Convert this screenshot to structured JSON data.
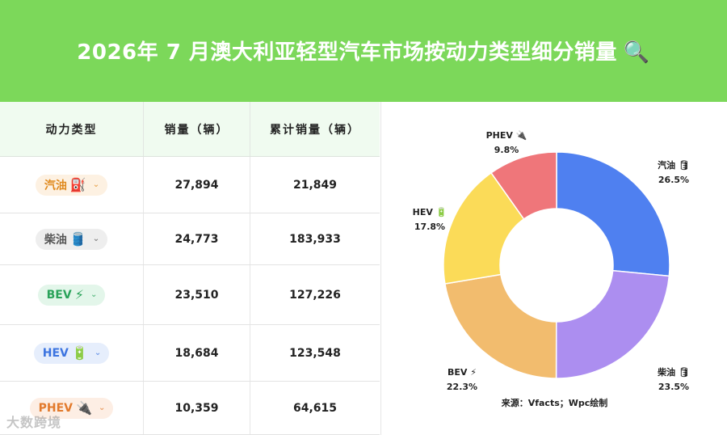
{
  "header": {
    "title": "2026年 7 月澳大利亚轻型汽车市场按动力类型细分销量",
    "icon": "🔍"
  },
  "table": {
    "headers": [
      "动力类型",
      "销量（辆）",
      "累计销量（辆）"
    ],
    "rows": [
      {
        "type": "汽油",
        "emoji": "⛽",
        "sales": "27,894",
        "cumulative": "21,849",
        "chip_bg": "#fdf1e2",
        "chip_fg": "#e08a1e"
      },
      {
        "type": "柴油",
        "emoji": "🛢️",
        "sales": "24,773",
        "cumulative": "183,933",
        "chip_bg": "#eeeeee",
        "chip_fg": "#555555"
      },
      {
        "type": "BEV",
        "emoji": "⚡",
        "sales": "23,510",
        "cumulative": "127,226",
        "chip_bg": "#e3f6ea",
        "chip_fg": "#2aa35a"
      },
      {
        "type": "HEV",
        "emoji": "🔋",
        "sales": "18,684",
        "cumulative": "123,548",
        "chip_bg": "#e6eefc",
        "chip_fg": "#3c74e0"
      },
      {
        "type": "PHEV",
        "emoji": "🔌",
        "sales": "10,359",
        "cumulative": "64,615",
        "chip_bg": "#fdeee4",
        "chip_fg": "#e27a2c"
      }
    ]
  },
  "chart_data": {
    "type": "pie",
    "categories": [
      "汽油",
      "柴油",
      "BEV",
      "HEV",
      "PHEV"
    ],
    "values": [
      26.5,
      23.5,
      22.3,
      17.8,
      9.8
    ],
    "labels": [
      "汽油 🛢",
      "柴油 🛢",
      "BEV ⚡",
      "HEV 🔋",
      "PHEV 🔌"
    ],
    "percent_labels": [
      "26.5%",
      "23.5%",
      "22.3%",
      "17.8%",
      "9.8%"
    ],
    "colors": [
      "#4f80f0",
      "#ac8ef0",
      "#f2bc6e",
      "#fbdb58",
      "#ef767a"
    ],
    "donut": true
  },
  "source_text": "来源：Vfacts；Wpc绘制",
  "watermark_text": "大数跨境"
}
